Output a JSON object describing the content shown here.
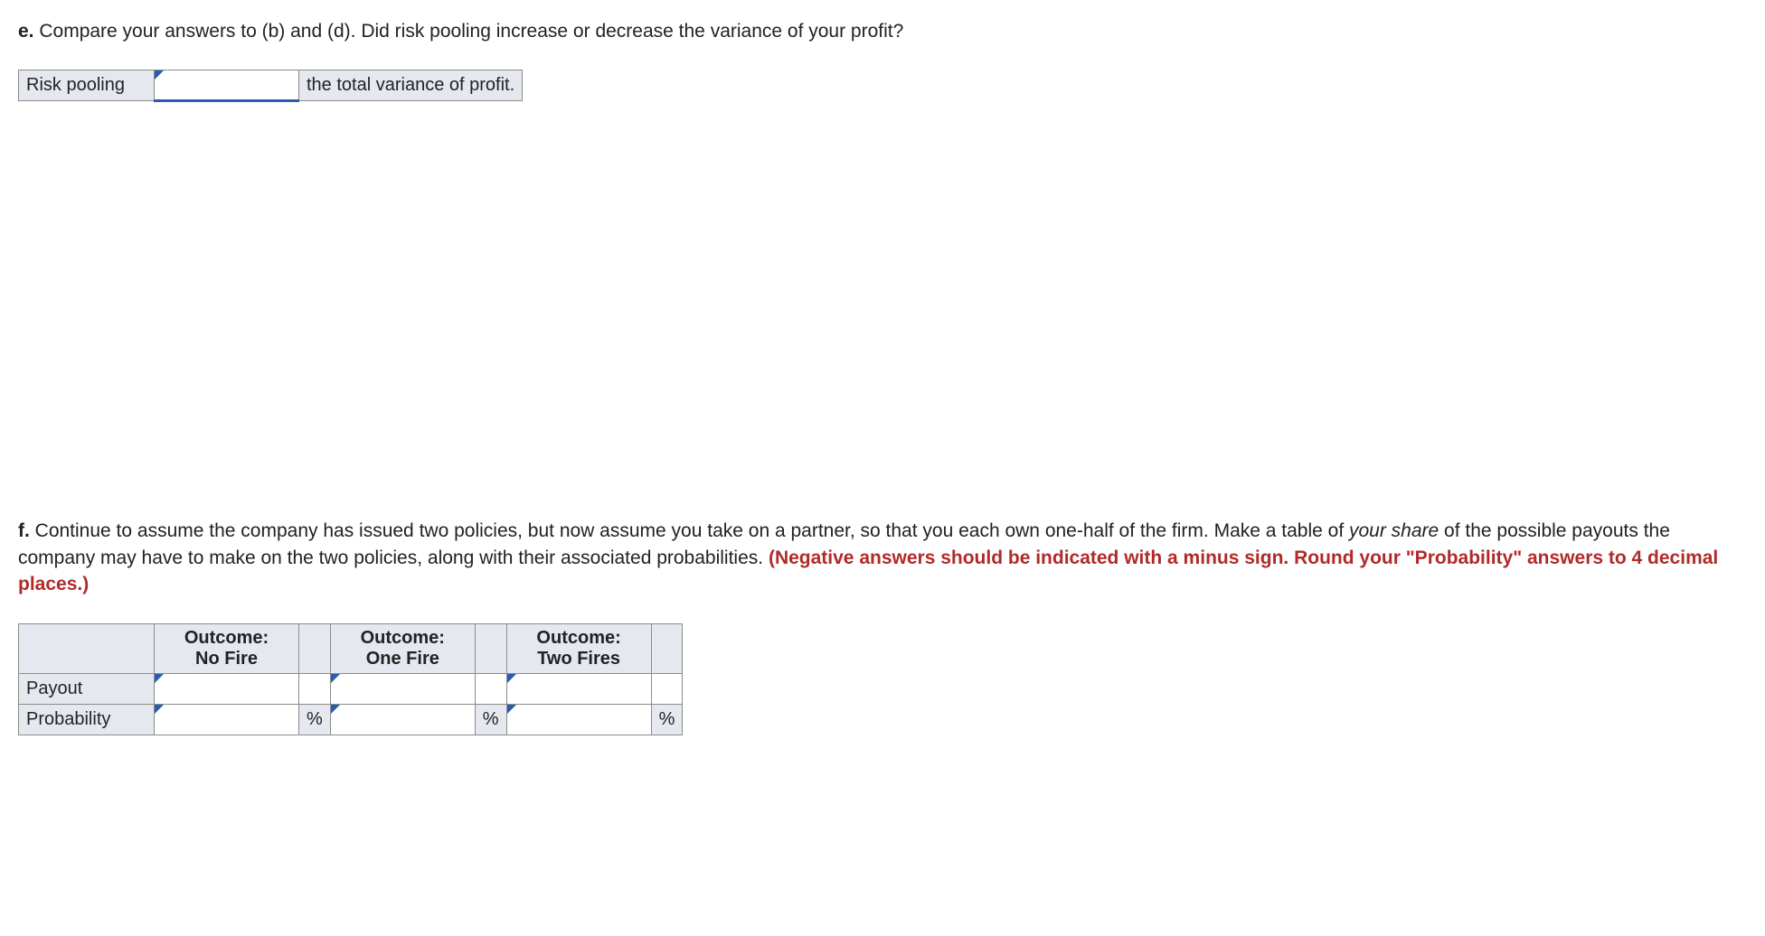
{
  "partE": {
    "label": "e.",
    "text": " Compare your answers to (b) and (d). Did risk pooling increase or decrease the variance of your profit?",
    "table": {
      "c1": "Risk pooling",
      "c2": "",
      "c3": "the total variance of profit."
    }
  },
  "partF": {
    "label": "f.",
    "text_a": " Continue to assume the company has issued two policies, but now assume you take on a partner, so that you each own one-half of the firm. Make a table of ",
    "italic": "your share",
    "text_b": " of the possible payouts the company may have to make on the two policies, along with their associated probabilities. ",
    "red": "(Negative answers should be indicated with a minus sign. Round your \"Probability\" answers to 4 decimal places.)",
    "table": {
      "blank": "",
      "h1a": "Outcome:",
      "h1b": "No Fire",
      "h2a": "Outcome:",
      "h2b": "One Fire",
      "h3a": "Outcome:",
      "h3b": "Two Fires",
      "r1": "Payout",
      "r2": "Probability",
      "pct": "%"
    }
  }
}
